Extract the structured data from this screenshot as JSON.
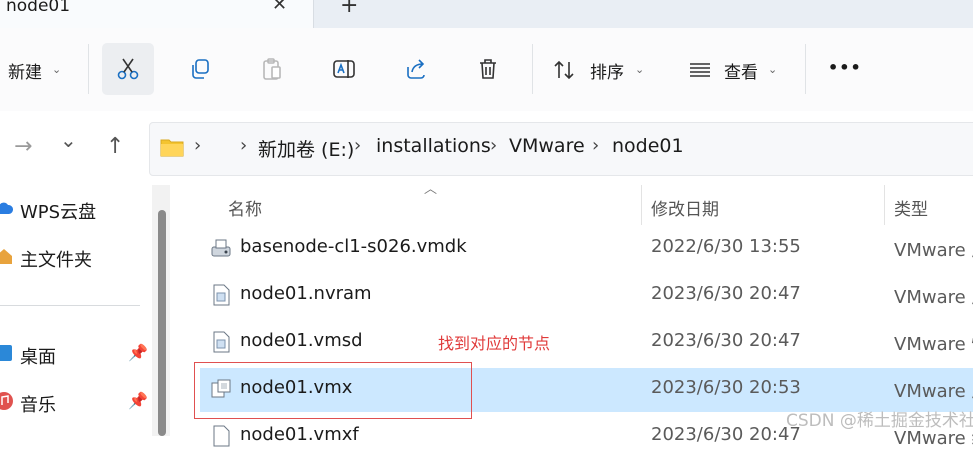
{
  "tab": {
    "title": "node01",
    "close": "✕",
    "new": "+"
  },
  "toolbar": {
    "new_label": "新建",
    "sort_label": "排序",
    "view_label": "查看",
    "more": "•••"
  },
  "nav": {
    "forward": "→",
    "recent": "⌄",
    "up": "↑"
  },
  "address": {
    "crumbs": [
      "新加卷 (E:)",
      "installations",
      "VMware",
      "node01"
    ],
    "sep": "›"
  },
  "sidebar": {
    "items": [
      {
        "label": "WPS云盘"
      },
      {
        "label": "主文件夹"
      },
      {
        "label": "桌面"
      },
      {
        "label": "音乐"
      }
    ]
  },
  "columns": {
    "name": "名称",
    "date": "修改日期",
    "type": "类型"
  },
  "files": [
    {
      "name": "basenode-cl1-s026.vmdk",
      "date": "2022/6/30 13:55",
      "type": "VMware 虚"
    },
    {
      "name": "node01.nvram",
      "date": "2023/6/30 20:47",
      "type": "VMware 虚"
    },
    {
      "name": "node01.vmsd",
      "date": "2023/6/30 20:47",
      "type": "VMware 快"
    },
    {
      "name": "node01.vmx",
      "date": "2023/6/30 20:53",
      "type": "VMware 虚"
    },
    {
      "name": "node01.vmxf",
      "date": "2023/6/30 20:47",
      "type": "VMware 组"
    }
  ],
  "annotation": "找到对应的节点",
  "watermark": "CSDN @稀土掘金技术社区",
  "colors": {
    "selected": "#cce8ff",
    "annotation": "#e05050",
    "folder": "#f4c430"
  }
}
